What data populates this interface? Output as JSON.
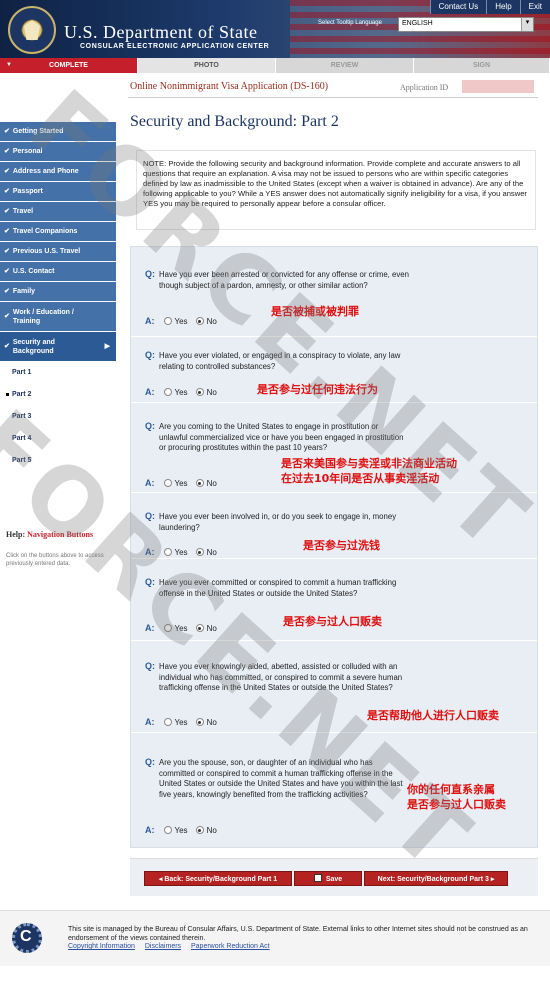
{
  "header": {
    "site_title": "U.S. Department of State",
    "site_subtitle": "CONSULAR ELECTRONIC APPLICATION CENTER",
    "top_links": [
      "Contact Us",
      "Help",
      "Exit"
    ],
    "language_label": "Select Tooltip Language",
    "language_value": "ENGLISH"
  },
  "steps": {
    "complete": "COMPLETE",
    "photo": "PHOTO",
    "review": "REVIEW",
    "sign": "SIGN"
  },
  "sidebar": {
    "items": [
      "Getting Started",
      "Personal",
      "Address and Phone",
      "Passport",
      "Travel",
      "Travel Companions",
      "Previous U.S. Travel",
      "U.S. Contact",
      "Family",
      "Work / Education / Training",
      "Security and Background"
    ],
    "parts": [
      "Part 1",
      "Part 2",
      "Part 3",
      "Part 4",
      "Part 5"
    ],
    "help_title_prefix": "Help:",
    "help_title": "Navigation Buttons",
    "help_text": "Click on the buttons above to access previously entered data."
  },
  "main": {
    "app_title": "Online Nonimmigrant Visa Application (DS-160)",
    "app_id_label": "Application ID",
    "page_title": "Security and Background: Part 2",
    "note": "NOTE: Provide the following security and background information. Provide complete and accurate answers to all questions that require an explanation. A visa may not be issued to persons who are within specific categories defined by law as inadmissible to the United States (except when a waiver is obtained in advance). Are any of the following applicable to you? While a YES answer does not automatically signify ineligibility for a visa, if you answer YES you may be required to personally appear before a consular officer.",
    "q_letter": "Q:",
    "a_letter": "A:",
    "yes": "Yes",
    "no": "No",
    "questions": [
      {
        "text": "Have you ever been arrested or convicted for any offense or crime, even though subject of a pardon, amnesty, or other similar action?",
        "answer": "No",
        "annotation": "是否被捕或被判罪"
      },
      {
        "text": "Have you ever violated, or engaged in a conspiracy to violate, any law relating to controlled substances?",
        "answer": "No",
        "annotation": "是否参与过任何违法行为"
      },
      {
        "text": "Are you coming to the United States to engage in prostitution or unlawful commercialized vice or have you been engaged in prostitution or procuring prostitutes within the past 10 years?",
        "answer": "No",
        "annotation": "是否来美国参与卖淫或非法商业活动",
        "annotation2": "在过去10年间是否从事卖淫活动"
      },
      {
        "text": "Have you ever been involved in, or do you seek to engage in, money laundering?",
        "answer": "No",
        "annotation": "是否参与过洗钱"
      },
      {
        "text": "Have you ever committed or conspired to commit a human trafficking offense in the United States or outside the United States?",
        "answer": "No",
        "annotation": "是否参与过人口贩卖"
      },
      {
        "text": "Have you ever knowingly aided, abetted, assisted or colluded with an individual who has committed, or conspired to commit a severe human trafficking offense in the United States or outside the United States?",
        "answer": "No",
        "annotation": "是否帮助他人进行人口贩卖"
      },
      {
        "text": "Are you the spouse, son, or daughter of an individual who has committed or conspired to commit a human trafficking offense in the United States or outside the United States and have you within the last five years, knowingly benefited from the trafficking activities?",
        "answer": "No",
        "annotation": "你的任何直系亲属",
        "annotation2": "是否参与过人口贩卖"
      }
    ]
  },
  "buttons": {
    "back": "◂ Back: Security/Background Part 1",
    "save": "Save",
    "next": "Next: Security/Background Part 3 ▸"
  },
  "footer": {
    "text": "This site is managed by the Bureau of Consular Affairs, U.S. Department of State. External links to other Internet sites should not be construed as an endorsement of the views contained therein.",
    "links": [
      "Copyright Information",
      "Disclaimers",
      "Paperwork Reduction Act"
    ]
  },
  "watermark": "FORCE.NET"
}
